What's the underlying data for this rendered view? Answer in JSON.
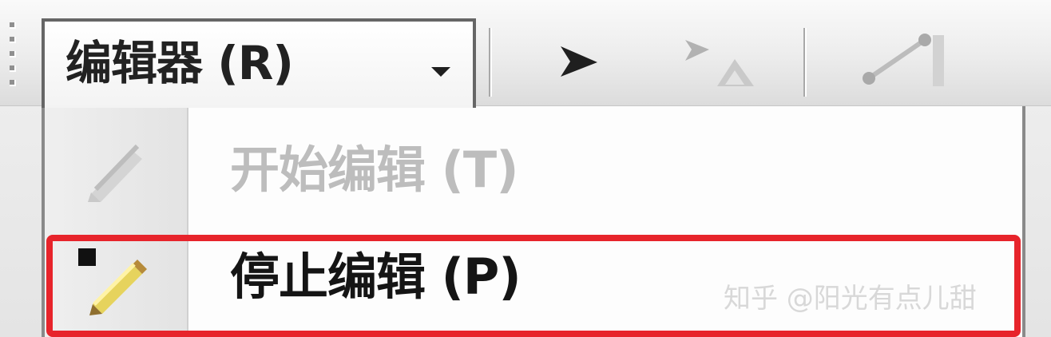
{
  "toolbar": {
    "editor_menu": {
      "label": "编辑器 (R)",
      "arrow_icon": "chevron-down-icon"
    },
    "tools": [
      {
        "name": "select-arrow-icon"
      },
      {
        "name": "edit-vertex-icon"
      },
      {
        "name": "line-tool-icon"
      }
    ]
  },
  "menu": {
    "items": [
      {
        "label": "开始编辑 (T)",
        "icon": "pencil-icon",
        "enabled": false
      },
      {
        "label": "停止编辑 (P)",
        "icon": "stop-edit-icon",
        "enabled": true
      }
    ]
  },
  "watermark": {
    "text": "知乎 @阳光有点儿甜"
  },
  "colors": {
    "highlight": "#e7242b",
    "menu_bg": "#fdfdfd",
    "toolbar_bg": "#ececec"
  }
}
